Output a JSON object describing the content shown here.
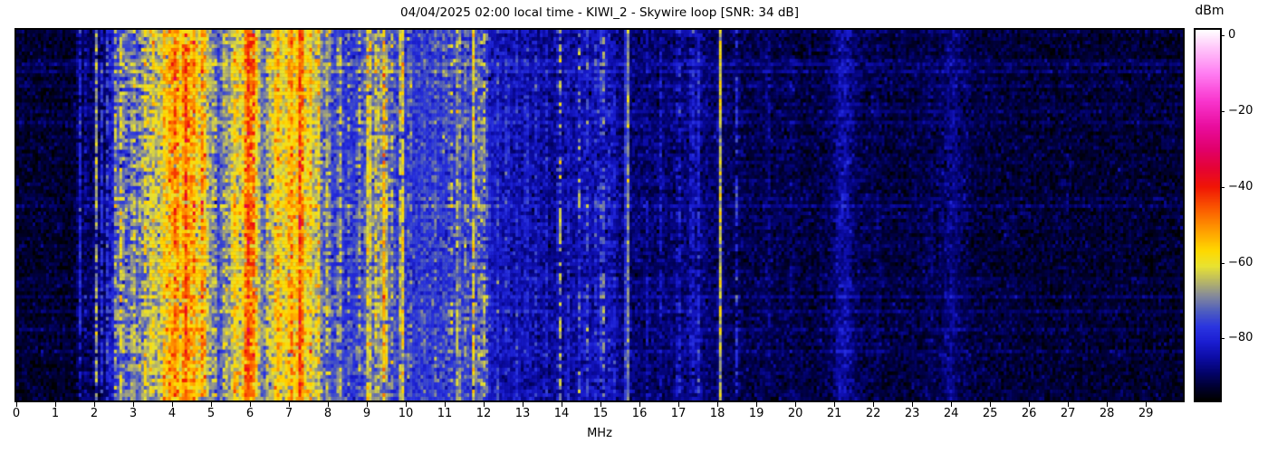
{
  "chart_data": {
    "type": "heatmap",
    "subtype": "radio-spectrogram-waterfall",
    "title": "04/04/2025 02:00 local time - KIWI_2 - Skywire loop [SNR: 34 dB]",
    "xlabel": "MHz",
    "x_range": [
      0,
      29.95
    ],
    "x_ticks": [
      0,
      1,
      2,
      3,
      4,
      5,
      6,
      7,
      8,
      9,
      10,
      11,
      12,
      13,
      14,
      15,
      16,
      17,
      18,
      19,
      20,
      21,
      22,
      23,
      24,
      25,
      26,
      27,
      28,
      29
    ],
    "y_axis": "time (no visible tick labels)",
    "grid": {
      "cols": 430,
      "rows": 102
    },
    "seed": 7,
    "noise": {
      "sigma_base": 2.2,
      "sigma_gain": 0.07,
      "sigma_max": 5.2,
      "row_streak_prob": 0.09,
      "row_streak_boost": 3.0
    },
    "colorbar": {
      "label": "dBm",
      "vmax": 1.5,
      "vmin": -96.4,
      "ticks": [
        {
          "v": 0,
          "label": "0"
        },
        {
          "v": -20,
          "label": "−20"
        },
        {
          "v": -40,
          "label": "−40"
        },
        {
          "v": -60,
          "label": "−60"
        },
        {
          "v": -80,
          "label": "−80"
        }
      ]
    },
    "colormap_stops": [
      [
        1.5,
        "#ffffff"
      ],
      [
        -3,
        "#ffc8fa"
      ],
      [
        -10,
        "#ff7df2"
      ],
      [
        -17,
        "#f937cf"
      ],
      [
        -24,
        "#e90d9e"
      ],
      [
        -30,
        "#e1006b"
      ],
      [
        -35,
        "#e50335"
      ],
      [
        -40,
        "#f01505"
      ],
      [
        -46,
        "#fb5c00"
      ],
      [
        -52,
        "#ffa300"
      ],
      [
        -57,
        "#ffd900"
      ],
      [
        -61,
        "#e8e332"
      ],
      [
        -65,
        "#b8b766"
      ],
      [
        -69,
        "#83889c"
      ],
      [
        -73,
        "#4d5cc0"
      ],
      [
        -77,
        "#2b35e0"
      ],
      [
        -81,
        "#1b1ed2"
      ],
      [
        -85,
        "#0d0da8"
      ],
      [
        -89,
        "#03036e"
      ],
      [
        -93,
        "#000030"
      ],
      [
        -96.4,
        "#000000"
      ]
    ],
    "noise_floor_profile_mhz_dbm": [
      [
        0,
        -93
      ],
      [
        1.5,
        -93
      ],
      [
        1.7,
        -91
      ],
      [
        2.3,
        -90
      ],
      [
        2.45,
        -83
      ],
      [
        2.6,
        -79
      ],
      [
        3.0,
        -77
      ],
      [
        3.3,
        -72
      ],
      [
        3.6,
        -69
      ],
      [
        4.0,
        -63
      ],
      [
        4.3,
        -60
      ],
      [
        4.7,
        -61
      ],
      [
        5.0,
        -68
      ],
      [
        5.15,
        -76
      ],
      [
        5.45,
        -70
      ],
      [
        5.6,
        -66
      ],
      [
        5.8,
        -62
      ],
      [
        6.0,
        -60
      ],
      [
        6.2,
        -63
      ],
      [
        6.35,
        -73
      ],
      [
        6.6,
        -64
      ],
      [
        6.9,
        -61
      ],
      [
        7.2,
        -59
      ],
      [
        7.5,
        -62
      ],
      [
        7.7,
        -68
      ],
      [
        7.9,
        -73
      ],
      [
        8.1,
        -76
      ],
      [
        8.6,
        -78
      ],
      [
        9.0,
        -75
      ],
      [
        9.1,
        -73
      ],
      [
        9.35,
        -71
      ],
      [
        9.6,
        -75
      ],
      [
        10.0,
        -78
      ],
      [
        10.3,
        -77
      ],
      [
        11.0,
        -77
      ],
      [
        11.4,
        -76
      ],
      [
        11.9,
        -78
      ],
      [
        12.2,
        -82
      ],
      [
        12.5,
        -84
      ],
      [
        13.3,
        -85
      ],
      [
        13.6,
        -87
      ],
      [
        14.2,
        -86
      ],
      [
        14.6,
        -84
      ],
      [
        15.1,
        -85
      ],
      [
        15.5,
        -88
      ],
      [
        16.0,
        -89
      ],
      [
        16.8,
        -89
      ],
      [
        17.2,
        -88
      ],
      [
        17.6,
        -88
      ],
      [
        18.0,
        -90
      ],
      [
        18.6,
        -91
      ],
      [
        19.5,
        -91
      ],
      [
        20.5,
        -92
      ],
      [
        21.0,
        -90.5
      ],
      [
        21.3,
        -89.5
      ],
      [
        21.6,
        -91
      ],
      [
        22.5,
        -92
      ],
      [
        23.8,
        -91
      ],
      [
        24.2,
        -91
      ],
      [
        24.6,
        -92
      ],
      [
        26.0,
        -92.5
      ],
      [
        29.95,
        -93
      ]
    ],
    "carriers_mhz_width_amp_gate": [
      [
        1.62,
        0.03,
        14,
        0.85
      ],
      [
        1.8,
        0.03,
        8,
        0.6
      ],
      [
        2.05,
        0.03,
        23,
        0.85
      ],
      [
        2.2,
        0.03,
        12,
        0.7
      ],
      [
        2.35,
        0.03,
        15,
        0.75
      ],
      [
        2.55,
        0.04,
        13,
        0.8
      ],
      [
        2.7,
        0.05,
        17,
        0.85
      ],
      [
        2.85,
        0.04,
        10,
        0.6
      ],
      [
        3.0,
        0.05,
        13,
        0.8
      ],
      [
        3.15,
        0.04,
        8,
        0.6
      ],
      [
        3.3,
        0.05,
        11,
        0.8
      ],
      [
        3.5,
        0.06,
        10,
        0.85
      ],
      [
        3.65,
        0.04,
        7,
        0.6
      ],
      [
        3.8,
        0.05,
        9,
        0.85
      ],
      [
        3.95,
        0.06,
        11,
        0.9
      ],
      [
        4.1,
        0.05,
        14,
        0.9
      ],
      [
        4.35,
        0.06,
        16,
        0.9
      ],
      [
        4.55,
        0.05,
        10,
        0.8
      ],
      [
        4.8,
        0.05,
        14,
        0.85
      ],
      [
        5.1,
        0.04,
        9,
        0.6
      ],
      [
        5.35,
        0.05,
        8,
        0.7
      ],
      [
        5.6,
        0.06,
        9,
        0.85
      ],
      [
        5.95,
        0.07,
        16,
        0.95
      ],
      [
        6.1,
        0.05,
        12,
        0.85
      ],
      [
        6.45,
        0.04,
        8,
        0.6
      ],
      [
        6.7,
        0.05,
        10,
        0.85
      ],
      [
        7.05,
        0.05,
        10,
        0.85
      ],
      [
        7.3,
        0.05,
        17,
        0.95
      ],
      [
        7.55,
        0.04,
        9,
        0.7
      ],
      [
        7.75,
        0.04,
        13,
        0.75
      ],
      [
        8.0,
        0.04,
        11,
        0.7
      ],
      [
        8.3,
        0.04,
        13,
        0.7
      ],
      [
        8.55,
        0.04,
        9,
        0.5
      ],
      [
        8.8,
        0.04,
        11,
        0.6
      ],
      [
        9.05,
        0.05,
        15,
        0.9
      ],
      [
        9.25,
        0.04,
        11,
        0.8
      ],
      [
        9.45,
        0.05,
        17,
        0.9
      ],
      [
        9.65,
        0.04,
        10,
        0.6
      ],
      [
        9.9,
        0.04,
        20,
        0.9
      ],
      [
        10.1,
        0.04,
        8,
        0.5
      ],
      [
        10.45,
        0.03,
        5,
        0.5
      ],
      [
        10.75,
        0.03,
        5,
        0.5
      ],
      [
        11.0,
        0.03,
        6,
        0.5
      ],
      [
        11.15,
        0.025,
        26,
        0.22
      ],
      [
        11.35,
        0.03,
        15,
        0.85
      ],
      [
        11.55,
        0.03,
        9,
        0.6
      ],
      [
        11.75,
        0.035,
        18,
        0.9
      ],
      [
        11.9,
        0.03,
        12,
        0.7
      ],
      [
        12.0,
        0.035,
        15,
        0.7
      ],
      [
        12.1,
        0.03,
        10,
        0.5
      ],
      [
        12.35,
        0.03,
        8,
        0.5
      ],
      [
        12.6,
        0.03,
        10,
        0.6
      ],
      [
        12.85,
        0.03,
        6,
        0.5
      ],
      [
        13.1,
        0.03,
        9,
        0.6
      ],
      [
        13.35,
        0.03,
        7,
        0.5
      ],
      [
        13.6,
        0.03,
        8,
        0.5
      ],
      [
        13.95,
        0.035,
        22,
        0.5
      ],
      [
        14.15,
        0.03,
        8,
        0.5
      ],
      [
        14.45,
        0.03,
        15,
        0.35
      ],
      [
        14.65,
        0.03,
        12,
        0.55
      ],
      [
        14.9,
        0.03,
        10,
        0.5
      ],
      [
        15.05,
        0.035,
        19,
        0.55
      ],
      [
        15.2,
        0.03,
        8,
        0.5
      ],
      [
        15.35,
        0.05,
        6,
        0.8
      ],
      [
        15.68,
        0.03,
        27,
        0.97
      ],
      [
        16.2,
        0.03,
        5,
        0.6
      ],
      [
        16.55,
        0.03,
        6,
        0.6
      ],
      [
        17.0,
        0.03,
        14,
        0.45
      ],
      [
        17.35,
        0.04,
        8,
        0.8
      ],
      [
        17.5,
        0.035,
        9,
        0.8
      ],
      [
        18.07,
        0.03,
        27,
        0.97
      ],
      [
        18.5,
        0.03,
        13,
        0.55
      ],
      [
        19.3,
        0.05,
        3,
        0.7
      ],
      [
        19.9,
        0.04,
        3,
        0.6
      ],
      [
        21.25,
        0.18,
        5,
        1
      ],
      [
        22.1,
        0.06,
        2,
        0.6
      ],
      [
        23.5,
        0.06,
        2,
        0.5
      ],
      [
        24.0,
        0.15,
        3.5,
        1
      ],
      [
        24.4,
        0.06,
        2,
        0.5
      ],
      [
        25.5,
        0.05,
        1.5,
        0.5
      ],
      [
        27.0,
        0.05,
        1.5,
        0.5
      ],
      [
        28.3,
        0.05,
        1.5,
        0.5
      ]
    ]
  }
}
